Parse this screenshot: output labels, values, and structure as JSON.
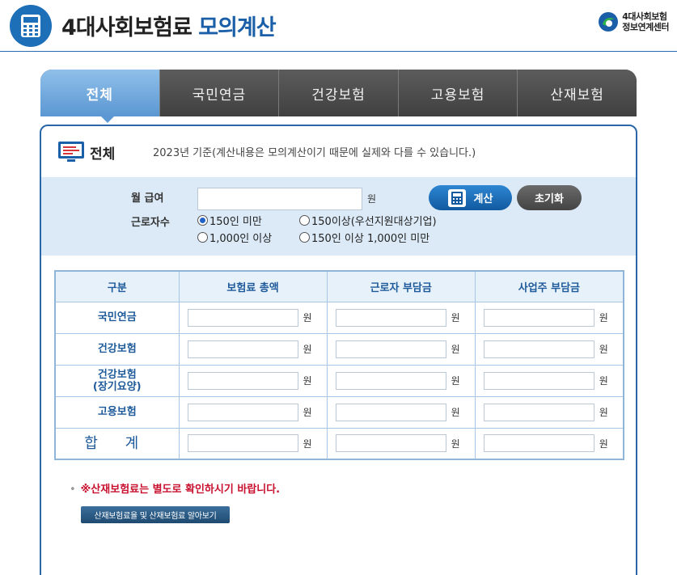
{
  "header": {
    "title_prefix": "4대사회보험료",
    "title_accent": "모의계산",
    "brand_line1": "4대사회보험",
    "brand_line2": "정보연계센터"
  },
  "tabs": [
    {
      "label": "전체",
      "active": true
    },
    {
      "label": "국민연금",
      "active": false
    },
    {
      "label": "건강보험",
      "active": false
    },
    {
      "label": "고용보험",
      "active": false
    },
    {
      "label": "산재보험",
      "active": false
    }
  ],
  "section": {
    "title": "전체",
    "basis_note": "2023년 기준(계산내용은 모의계산이기 때문에 실제와 다를 수 있습니다.)"
  },
  "form": {
    "salary_label": "월 급여",
    "salary_value": "",
    "won": "원",
    "calc_label": "계산",
    "reset_label": "초기화",
    "workers_label": "근로자수",
    "options": [
      {
        "label": "150인 미만",
        "selected": true
      },
      {
        "label": "150이상(우선지원대상기업)",
        "selected": false
      },
      {
        "label": "1,000인 이상",
        "selected": false
      },
      {
        "label": "150인 이상 1,000인 미만",
        "selected": false
      }
    ]
  },
  "table": {
    "headers": [
      "구분",
      "보험료 총액",
      "근로자 부담금",
      "사업주 부담금"
    ],
    "rows": [
      {
        "label": "국민연금",
        "label2": ""
      },
      {
        "label": "건강보험",
        "label2": ""
      },
      {
        "label": "건강보험",
        "label2": "(장기요양)"
      },
      {
        "label": "고용보험",
        "label2": ""
      },
      {
        "label": "합 계",
        "label2": ""
      }
    ],
    "unit": "원"
  },
  "notice": "※산재보험료는 별도로 확인하시기 바랍니다.",
  "link_button": "산재보험료율 및 산재보험료 알아보기",
  "colors": {
    "accent": "#1a5fa8",
    "tab_active": "#5b97d2",
    "notice": "#c8102e"
  }
}
